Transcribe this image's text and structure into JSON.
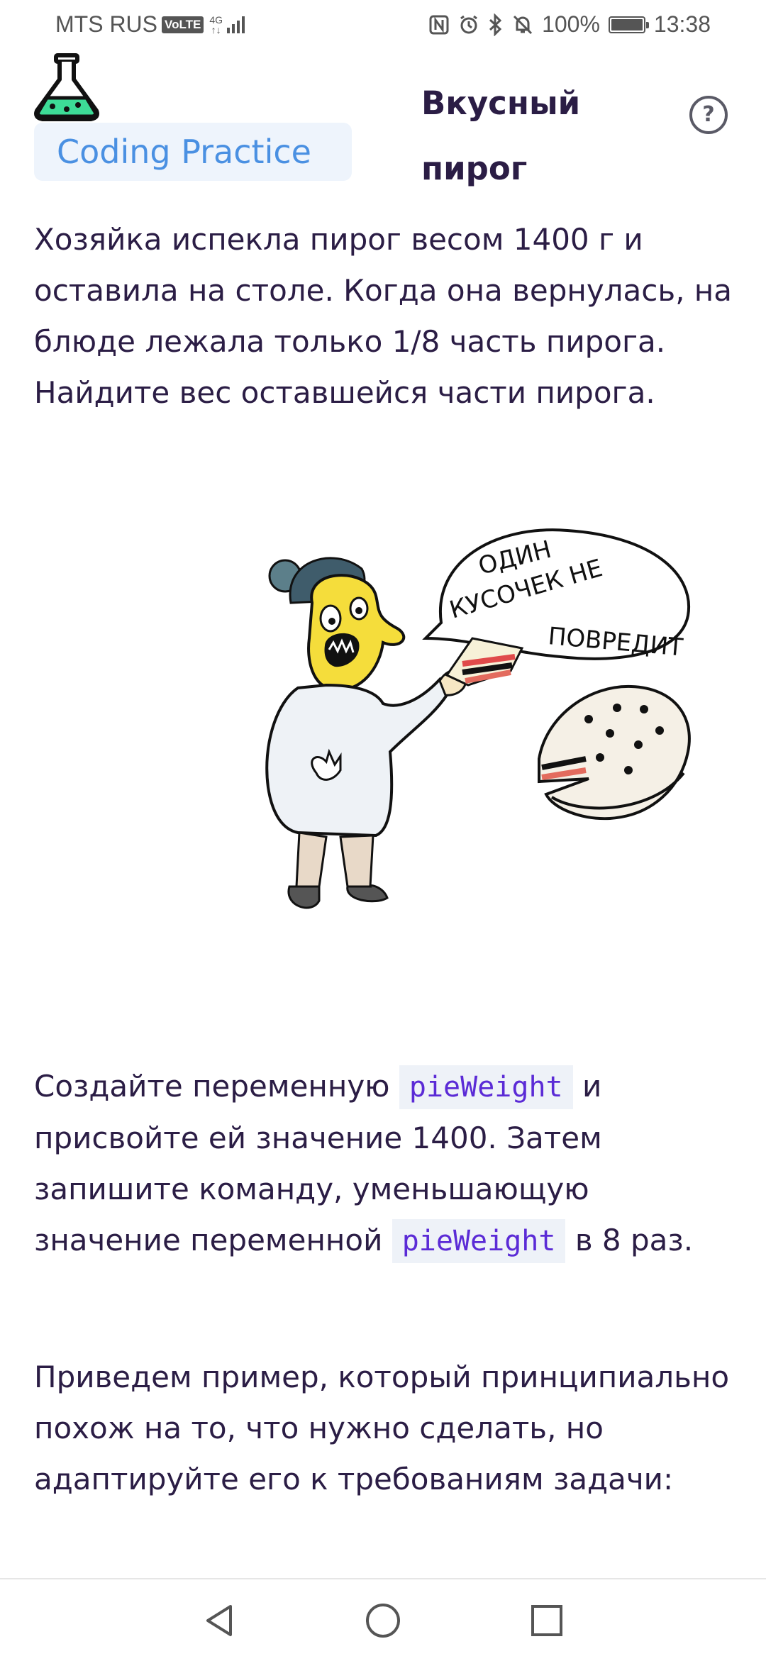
{
  "status_bar": {
    "carrier": "MTS RUS",
    "volte": "VoLTE",
    "network_top": "4G",
    "network_bottom": "↑↓",
    "battery_percent": "100%",
    "battery_level": 1.0,
    "time": "13:38",
    "icons": [
      "nfc-icon",
      "alarm-icon",
      "bluetooth-icon",
      "mute-icon",
      "battery-icon"
    ]
  },
  "header": {
    "app_name": "Coding Practice",
    "logo_icon": "flask-icon",
    "title": "Вкусный пирог",
    "help_symbol": "?"
  },
  "content": {
    "problem": "Хозяйка испекла пирог весом 1400 г и оставила на столе. Когда она вернулась, на блюде лежала только 1/8 часть пирога. Найдите вес оставшейся части пирога.",
    "illustration": {
      "speech_line1": "ОДИН",
      "speech_line2": "КУСОЧЕК НЕ",
      "speech_line3": "ПОВРЕДИТ"
    },
    "task": {
      "part1": "Создайте переменную ",
      "code1": "pieWeight",
      "part2": " и присвойте ей значение 1400. Затем запишите команду, уменьшающую значение переменной ",
      "code2": "pieWeight",
      "part3": " в 8 раз."
    },
    "hint": "Приведем пример, который принципиально похож на то, что нужно сделать, но адаптируйте его к требованиям задачи:"
  },
  "nav": {
    "back": "back-icon",
    "home": "home-icon",
    "recents": "recents-icon"
  },
  "colors": {
    "text": "#2b1d45",
    "accent": "#4a90e2",
    "code": "#5b2bd6",
    "flask_liquid": "#3ddc97"
  }
}
